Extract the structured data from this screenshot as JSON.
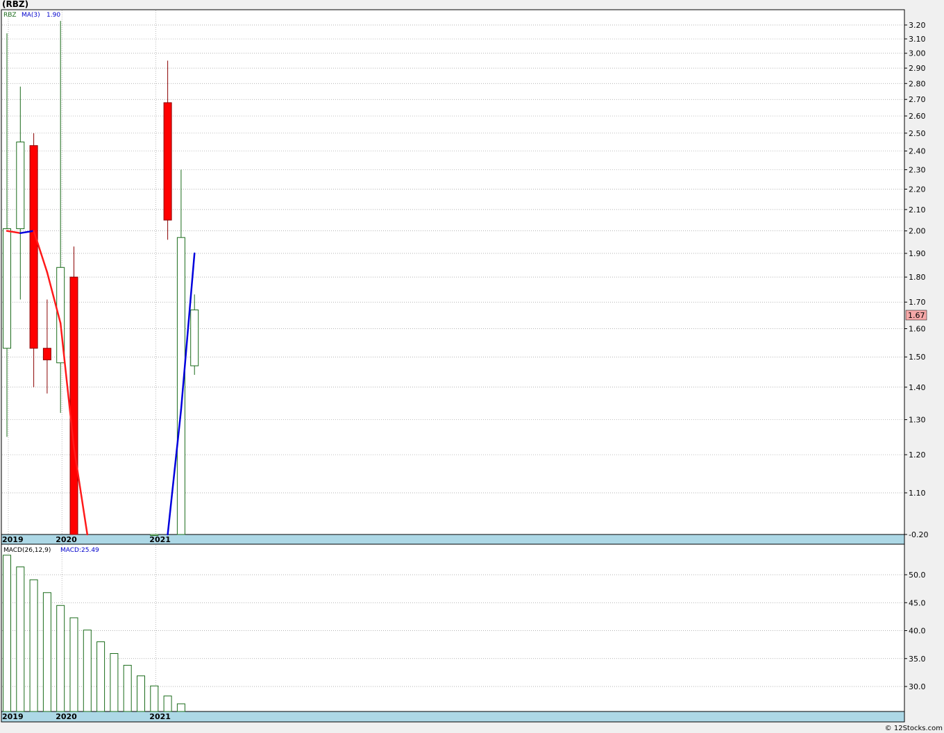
{
  "header": {
    "title": "(RBZ)"
  },
  "watermark": "© 12Stocks.com",
  "colors": {
    "up": "#1a6b1a",
    "down": "#ff0000",
    "down_wick": "#8b0000",
    "ma_falling": "#ff1a1a",
    "ma_rising": "#0000dd",
    "macd_bar": "#1a6b1a",
    "axis_band": "#add8e6",
    "last_price_bg": "#f5a8a8"
  },
  "chart_data": [
    {
      "type": "candlestick",
      "panel": "price",
      "legend": {
        "symbol": "RBZ",
        "ma_label": "MA(3)",
        "ma_value": "1.90"
      },
      "y_ticks": [
        "3.20",
        "3.10",
        "3.00",
        "2.90",
        "2.80",
        "2.70",
        "2.60",
        "2.50",
        "2.40",
        "2.30",
        "2.20",
        "2.10",
        "2.00",
        "1.90",
        "1.80",
        "1.70",
        "1.60",
        "1.50",
        "1.40",
        "1.30",
        "1.20",
        "1.10",
        "-0.20"
      ],
      "x_ticks": [
        "2019",
        "2020",
        "2021"
      ],
      "last_price": "1.67",
      "candles": [
        {
          "o": 1.53,
          "h": 3.14,
          "l": 1.25,
          "c": 2.01
        },
        {
          "o": 2.01,
          "h": 2.78,
          "l": 1.71,
          "c": 2.45
        },
        {
          "o": 2.43,
          "h": 2.5,
          "l": 1.4,
          "c": 1.53
        },
        {
          "o": 1.53,
          "h": 1.71,
          "l": 1.38,
          "c": 1.49
        },
        {
          "o": 1.48,
          "h": 3.23,
          "l": 1.32,
          "c": 1.84
        },
        {
          "o": 1.8,
          "h": 1.93,
          "l": -0.2,
          "c": -0.2
        },
        null,
        null,
        null,
        null,
        null,
        {
          "o": -0.2,
          "h": -0.2,
          "l": -0.2,
          "c": -0.2
        },
        {
          "o": 2.68,
          "h": 2.95,
          "l": 1.96,
          "c": 2.05
        },
        {
          "o": -0.2,
          "h": 2.3,
          "l": -0.2,
          "c": 1.97
        },
        {
          "o": 1.47,
          "h": 1.73,
          "l": 1.44,
          "c": 1.67
        }
      ],
      "ma": [
        2.0,
        1.99,
        2.0,
        1.82,
        1.62,
        1.22,
        -0.2,
        -0.2,
        -0.2,
        -0.2,
        -0.2,
        -0.2,
        -0.2,
        1.33,
        1.9
      ]
    },
    {
      "type": "bar",
      "panel": "macd",
      "legend": {
        "label": "MACD(26,12,9)",
        "value_label": "MACD:25.49"
      },
      "y_ticks": [
        "50.0",
        "45.0",
        "40.0",
        "35.0",
        "30.0"
      ],
      "x_ticks": [
        "2019",
        "2020",
        "2021"
      ],
      "values": [
        53.5,
        51.4,
        49.1,
        46.8,
        44.5,
        42.3,
        40.1,
        38.0,
        35.9,
        33.8,
        31.9,
        30.1,
        28.3,
        26.9
      ]
    }
  ]
}
